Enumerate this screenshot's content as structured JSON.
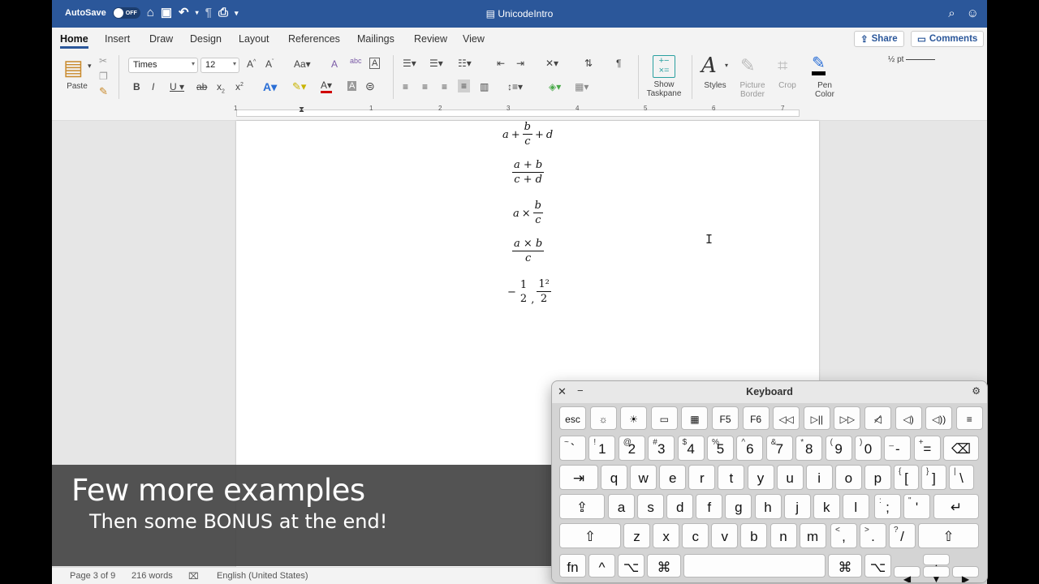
{
  "titlebar": {
    "autosave_label": "AutoSave",
    "autosave_state": "OFF",
    "doc_title": "UnicodeIntro"
  },
  "tabs": [
    "Home",
    "Insert",
    "Draw",
    "Design",
    "Layout",
    "References",
    "Mailings",
    "Review",
    "View"
  ],
  "share_label": "Share",
  "comments_label": "Comments",
  "ribbon": {
    "paste_label": "Paste",
    "font_name": "Times",
    "font_size": "12",
    "show_taskpane_label": "Show\nTaskpane",
    "styles_label": "Styles",
    "picture_border_label": "Picture\nBorder",
    "crop_label": "Crop",
    "pen_color_label": "Pen\nColor",
    "pen_weight": "½ pt"
  },
  "ruler_numbers": [
    "1",
    "1",
    "2",
    "3",
    "4",
    "5",
    "6",
    "7"
  ],
  "equations": [
    {
      "type": "a_plus_frac_plus_d",
      "a": "a",
      "plus": "+",
      "num": "b",
      "den": "c",
      "plus2": "+",
      "d": "d"
    },
    {
      "type": "frac",
      "num": "a + b",
      "den": "c + d"
    },
    {
      "type": "a_times_frac",
      "a": "a",
      "times": "×",
      "num": "b",
      "den": "c"
    },
    {
      "type": "frac",
      "num": "a × b",
      "den": "c"
    },
    {
      "type": "neg_half",
      "minus": "−",
      "num1": "1",
      "den1": "2",
      "comma": ",",
      "num2": "1²",
      "den2": "2"
    }
  ],
  "status": {
    "page": "Page 3 of 9",
    "words": "216 words",
    "language": "English (United States)"
  },
  "caption": {
    "line1": "Few more examples",
    "line2": "Then some BONUS at the end!"
  },
  "keyboard": {
    "title": "Keyboard",
    "fn_row": [
      "esc",
      "☼",
      "☀",
      "▭",
      "▦",
      "F5",
      "F6",
      "◁◁",
      "▷||",
      "▷▷",
      "◁̸",
      "◁)",
      "◁))",
      "≡"
    ],
    "num_row": [
      {
        "s": "~",
        "m": "`"
      },
      {
        "s": "!",
        "m": "1"
      },
      {
        "s": "@",
        "m": "2"
      },
      {
        "s": "#",
        "m": "3"
      },
      {
        "s": "$",
        "m": "4"
      },
      {
        "s": "%",
        "m": "5"
      },
      {
        "s": "^",
        "m": "6"
      },
      {
        "s": "&",
        "m": "7"
      },
      {
        "s": "*",
        "m": "8"
      },
      {
        "s": "(",
        "m": "9"
      },
      {
        "s": ")",
        "m": "0"
      },
      {
        "s": "_",
        "m": "-"
      },
      {
        "s": "+",
        "m": "="
      }
    ],
    "q_row": [
      "q",
      "w",
      "e",
      "r",
      "t",
      "y",
      "u",
      "i",
      "o",
      "p"
    ],
    "q_row_extra": [
      {
        "s": "{",
        "m": "["
      },
      {
        "s": "}",
        "m": "]"
      },
      {
        "s": "|",
        "m": "\\"
      }
    ],
    "a_row": [
      "a",
      "s",
      "d",
      "f",
      "g",
      "h",
      "j",
      "k",
      "l"
    ],
    "a_row_extra": [
      {
        "s": ":",
        "m": ";"
      },
      {
        "s": "\"",
        "m": "'"
      }
    ],
    "z_row": [
      "z",
      "x",
      "c",
      "v",
      "b",
      "n",
      "m"
    ],
    "z_row_extra": [
      {
        "s": "<",
        "m": ","
      },
      {
        "s": ">",
        "m": "."
      },
      {
        "s": "?",
        "m": "/"
      }
    ],
    "bottom": {
      "fn": "fn",
      "ctrl": "^",
      "opt": "⌥",
      "cmd": "⌘",
      "cmd2": "⌘",
      "opt2": "⌥"
    }
  }
}
